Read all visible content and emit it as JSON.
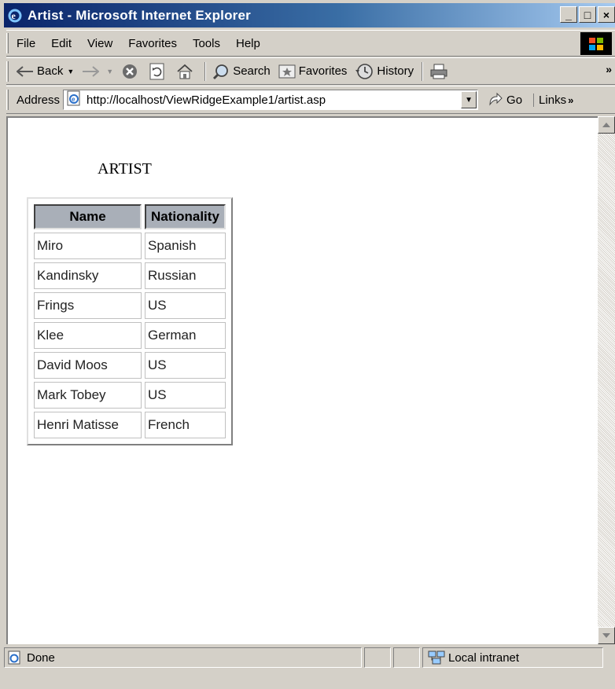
{
  "window": {
    "title": "Artist - Microsoft Internet Explorer",
    "controls": {
      "minimize": "_",
      "maximize": "□",
      "close": "×"
    }
  },
  "menu": [
    "File",
    "Edit",
    "View",
    "Favorites",
    "Tools",
    "Help"
  ],
  "toolbar": {
    "back_label": "Back",
    "search_label": "Search",
    "favorites_label": "Favorites",
    "history_label": "History",
    "overflow": "»"
  },
  "address": {
    "label": "Address",
    "url": "http://localhost/ViewRidgeExample1/artist.asp",
    "go_label": "Go",
    "links_label": "Links",
    "links_overflow": "»"
  },
  "page": {
    "heading": "ARTIST",
    "table": {
      "headers": [
        "Name",
        "Nationality"
      ],
      "rows": [
        [
          "Miro",
          "Spanish"
        ],
        [
          "Kandinsky",
          "Russian"
        ],
        [
          "Frings",
          "US"
        ],
        [
          "Klee",
          "German"
        ],
        [
          "David Moos",
          "US"
        ],
        [
          "Mark Tobey",
          "US"
        ],
        [
          "Henri Matisse",
          "French"
        ]
      ]
    }
  },
  "status": {
    "text": "Done",
    "zone": "Local intranet"
  },
  "colors": {
    "titlebar_start": "#0a246a",
    "titlebar_end": "#a6caf0",
    "chrome": "#d4d0c8",
    "table_header": "#a9afb8"
  },
  "icons": [
    "ie-page-icon",
    "back-arrow-icon",
    "forward-arrow-icon",
    "stop-icon",
    "refresh-icon",
    "home-icon",
    "search-icon",
    "favorites-icon",
    "history-icon",
    "print-icon",
    "go-arrow-icon",
    "windows-logo-icon",
    "local-intranet-icon"
  ]
}
